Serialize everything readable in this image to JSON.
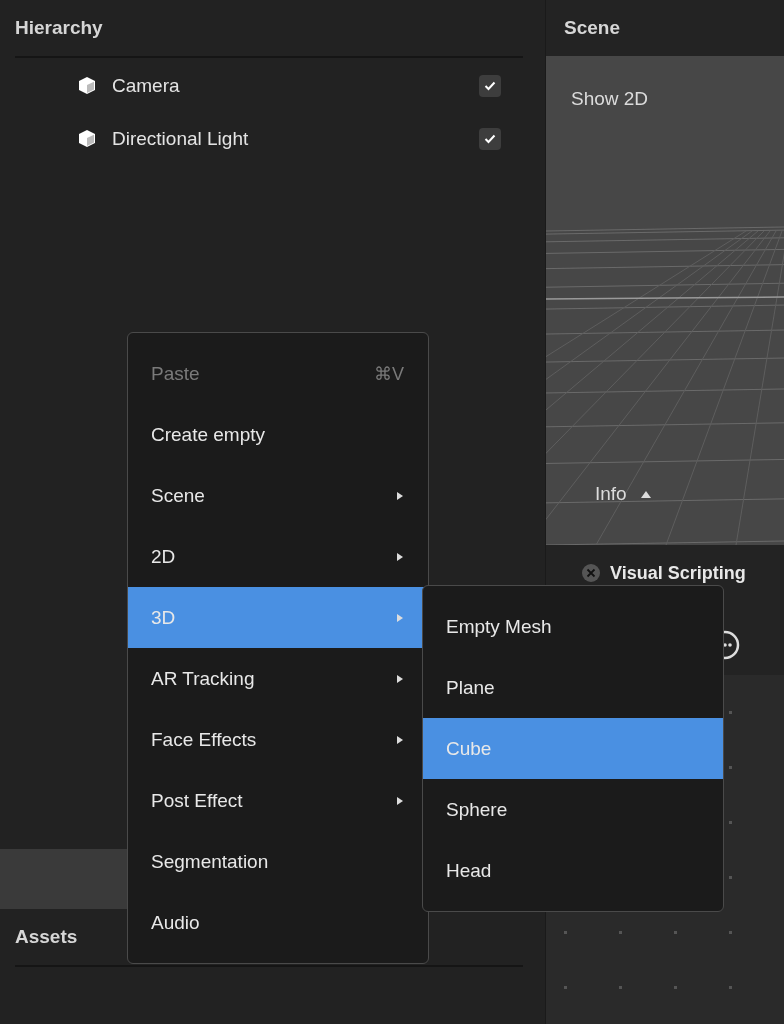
{
  "hierarchy": {
    "title": "Hierarchy",
    "items": [
      {
        "label": "Camera",
        "checked": true
      },
      {
        "label": "Directional Light",
        "checked": true
      }
    ]
  },
  "assets": {
    "title": "Assets"
  },
  "scene": {
    "title": "Scene",
    "toggle": "Show 2D",
    "info": "Info"
  },
  "visual_scripting": {
    "title": "Visual Scripting"
  },
  "context_menu": {
    "items": [
      {
        "label": "Paste",
        "shortcut": "⌘V",
        "disabled": true,
        "submenu": false,
        "selected": false
      },
      {
        "label": "Create empty",
        "disabled": false,
        "submenu": false,
        "selected": false
      },
      {
        "label": "Scene",
        "disabled": false,
        "submenu": true,
        "selected": false
      },
      {
        "label": "2D",
        "disabled": false,
        "submenu": true,
        "selected": false
      },
      {
        "label": "3D",
        "disabled": false,
        "submenu": true,
        "selected": true
      },
      {
        "label": "AR Tracking",
        "disabled": false,
        "submenu": true,
        "selected": false
      },
      {
        "label": "Face Effects",
        "disabled": false,
        "submenu": true,
        "selected": false
      },
      {
        "label": "Post Effect",
        "disabled": false,
        "submenu": true,
        "selected": false
      },
      {
        "label": "Segmentation",
        "disabled": false,
        "submenu": false,
        "selected": false
      },
      {
        "label": "Audio",
        "disabled": false,
        "submenu": false,
        "selected": false
      }
    ]
  },
  "submenu": {
    "items": [
      {
        "label": "Empty Mesh",
        "selected": false
      },
      {
        "label": "Plane",
        "selected": false
      },
      {
        "label": "Cube",
        "selected": true
      },
      {
        "label": "Sphere",
        "selected": false
      },
      {
        "label": "Head",
        "selected": false
      }
    ]
  }
}
